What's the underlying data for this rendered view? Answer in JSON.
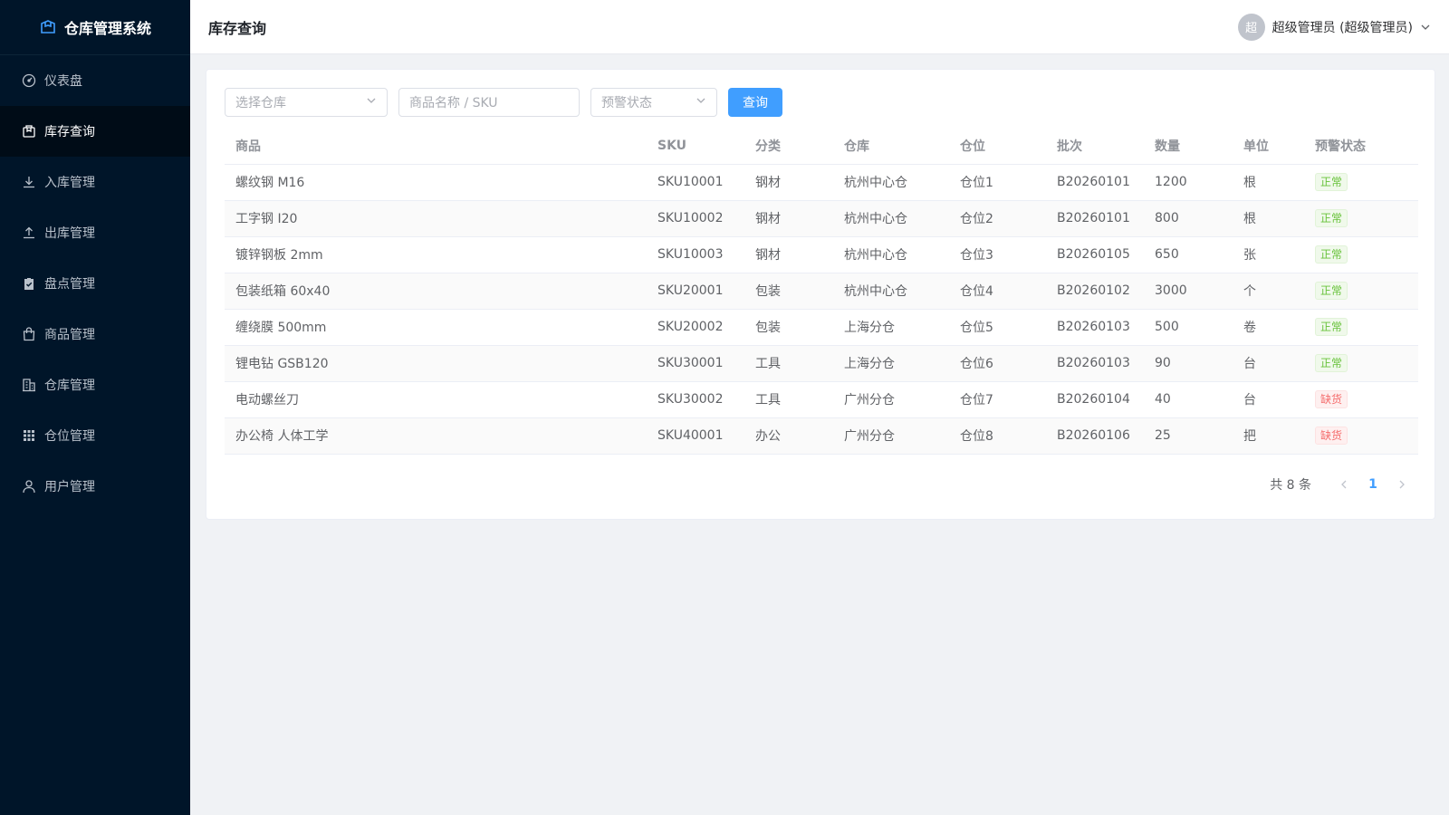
{
  "app": {
    "title": "仓库管理系统"
  },
  "sidebar": {
    "items": [
      {
        "label": "仪表盘",
        "icon": "dashboard-icon"
      },
      {
        "label": "库存查询",
        "icon": "box-icon",
        "active": true
      },
      {
        "label": "入库管理",
        "icon": "download-icon"
      },
      {
        "label": "出库管理",
        "icon": "upload-icon"
      },
      {
        "label": "盘点管理",
        "icon": "clipboard-check-icon"
      },
      {
        "label": "商品管理",
        "icon": "shopping-bag-icon"
      },
      {
        "label": "仓库管理",
        "icon": "building-icon"
      },
      {
        "label": "仓位管理",
        "icon": "grid-icon"
      },
      {
        "label": "用户管理",
        "icon": "user-icon"
      }
    ]
  },
  "header": {
    "title": "库存查询",
    "user": {
      "avatar_char": "超",
      "name": "超级管理员 (超级管理员)"
    }
  },
  "filters": {
    "warehouse_placeholder": "选择仓库",
    "search_placeholder": "商品名称 / SKU",
    "alert_placeholder": "预警状态",
    "query_label": "查询"
  },
  "table": {
    "columns": [
      "商品",
      "SKU",
      "分类",
      "仓库",
      "仓位",
      "批次",
      "数量",
      "单位",
      "预警状态"
    ],
    "rows": [
      [
        "螺纹钢 M16",
        "SKU10001",
        "钢材",
        "杭州中心仓",
        "仓位1",
        "B20260101",
        "1200",
        "根",
        "正常"
      ],
      [
        "工字钢 I20",
        "SKU10002",
        "钢材",
        "杭州中心仓",
        "仓位2",
        "B20260101",
        "800",
        "根",
        "正常"
      ],
      [
        "镀锌钢板 2mm",
        "SKU10003",
        "钢材",
        "杭州中心仓",
        "仓位3",
        "B20260105",
        "650",
        "张",
        "正常"
      ],
      [
        "包装纸箱 60x40",
        "SKU20001",
        "包装",
        "杭州中心仓",
        "仓位4",
        "B20260102",
        "3000",
        "个",
        "正常"
      ],
      [
        "缠绕膜 500mm",
        "SKU20002",
        "包装",
        "上海分仓",
        "仓位5",
        "B20260103",
        "500",
        "卷",
        "正常"
      ],
      [
        "锂电钻 GSB120",
        "SKU30001",
        "工具",
        "上海分仓",
        "仓位6",
        "B20260103",
        "90",
        "台",
        "正常"
      ],
      [
        "电动螺丝刀",
        "SKU30002",
        "工具",
        "广州分仓",
        "仓位7",
        "B20260104",
        "40",
        "台",
        "缺货"
      ],
      [
        "办公椅 人体工学",
        "SKU40001",
        "办公",
        "广州分仓",
        "仓位8",
        "B20260106",
        "25",
        "把",
        "缺货"
      ]
    ]
  },
  "pagination": {
    "total_text": "共 8 条",
    "current": "1"
  },
  "colors": {
    "sidebar_bg": "#001529",
    "primary": "#409eff",
    "ok": "#67c23a",
    "bad": "#f56c6c"
  }
}
